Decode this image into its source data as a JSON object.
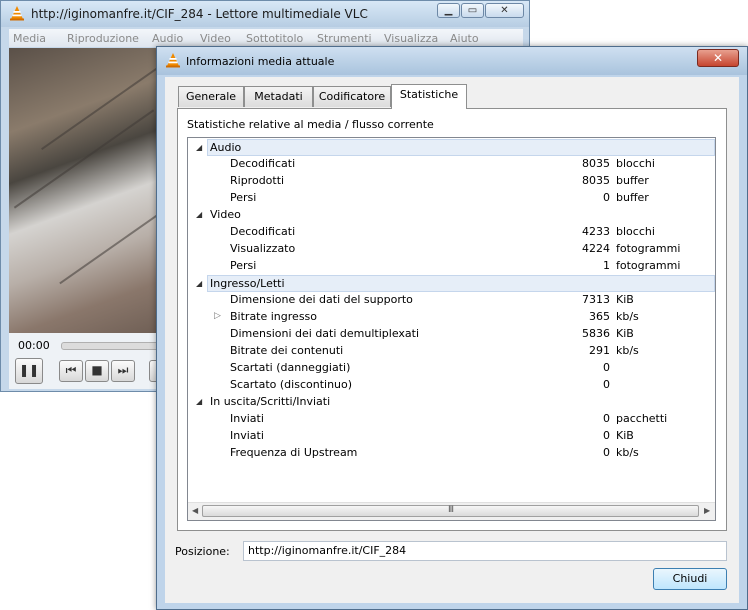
{
  "main_window": {
    "title": "http://iginomanfre.it/CIF_284 - Lettore multimediale VLC",
    "menu": [
      "Media",
      "Riproduzione",
      "Audio",
      "Video",
      "Sottotitolo",
      "Strumenti",
      "Visualizza",
      "Aiuto"
    ],
    "time": "00:00"
  },
  "dialog": {
    "title": "Informazioni media attuale",
    "close_glyph": "✕",
    "tabs": [
      "Generale",
      "Metadati",
      "Codificatore",
      "Statistiche"
    ],
    "active_tab": "Statistiche",
    "caption": "Statistiche relative al media / flusso corrente",
    "tree": [
      {
        "label": "Audio",
        "level": 0,
        "value": "",
        "unit": ""
      },
      {
        "label": "Decodificati",
        "level": 1,
        "value": "8035",
        "unit": "blocchi"
      },
      {
        "label": "Riprodotti",
        "level": 1,
        "value": "8035",
        "unit": "buffer"
      },
      {
        "label": "Persi",
        "level": 1,
        "value": "0",
        "unit": "buffer"
      },
      {
        "label": "Video",
        "level": 0,
        "value": "",
        "unit": ""
      },
      {
        "label": "Decodificati",
        "level": 1,
        "value": "4233",
        "unit": "blocchi"
      },
      {
        "label": "Visualizzato",
        "level": 1,
        "value": "4224",
        "unit": "fotogrammi"
      },
      {
        "label": "Persi",
        "level": 1,
        "value": "1",
        "unit": "fotogrammi"
      },
      {
        "label": "Ingresso/Letti",
        "level": 0,
        "value": "",
        "unit": ""
      },
      {
        "label": "Dimensione dei dati del supporto",
        "level": 1,
        "value": "7313",
        "unit": "KiB"
      },
      {
        "label": "Bitrate ingresso",
        "level": 1,
        "value": "365",
        "unit": "kb/s"
      },
      {
        "label": "Dimensioni dei dati demultiplexati",
        "level": 1,
        "value": "5836",
        "unit": "KiB"
      },
      {
        "label": "Bitrate dei contenuti",
        "level": 1,
        "value": "291",
        "unit": "kb/s"
      },
      {
        "label": "Scartati (danneggiati)",
        "level": 1,
        "value": "0",
        "unit": ""
      },
      {
        "label": "Scartato (discontinuo)",
        "level": 1,
        "value": "0",
        "unit": ""
      },
      {
        "label": "In uscita/Scritti/Inviati",
        "level": 0,
        "value": "",
        "unit": ""
      },
      {
        "label": "Inviati",
        "level": 1,
        "value": "0",
        "unit": "pacchetti"
      },
      {
        "label": "Inviati",
        "level": 1,
        "value": "0",
        "unit": "KiB"
      },
      {
        "label": "Frequenza di Upstream",
        "level": 1,
        "value": "0",
        "unit": "kb/s"
      }
    ],
    "position_label": "Posizione:",
    "position_value": "http://iginomanfre.it/CIF_284",
    "close_label": "Chiudi",
    "scroll_grip": "III"
  }
}
